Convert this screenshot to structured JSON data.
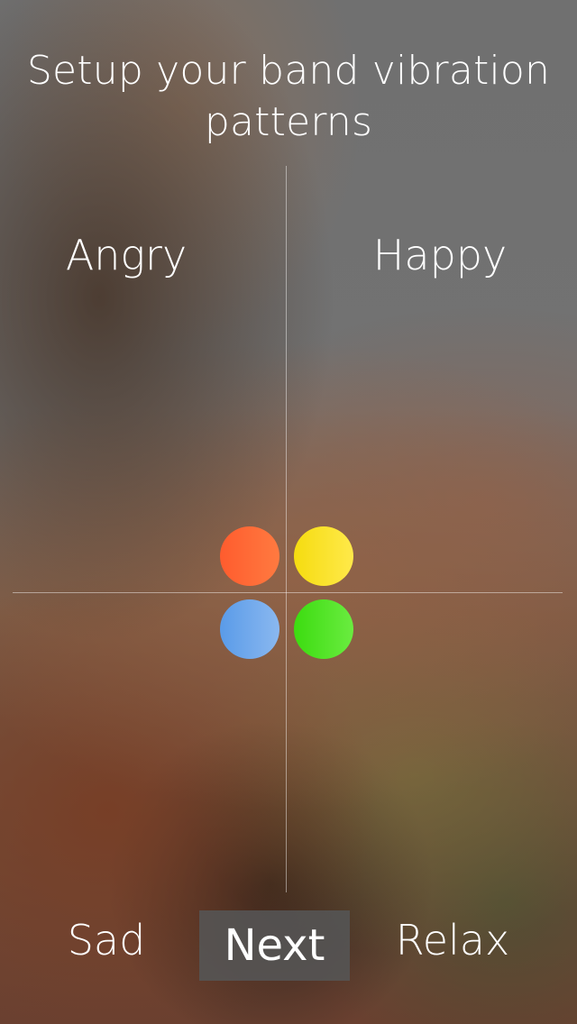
{
  "title": "Setup your band vibration patterns",
  "moods": {
    "top_left": {
      "label": "Angry",
      "color": "#FF5C2E",
      "color2": "#FF7A40"
    },
    "top_right": {
      "label": "Happy",
      "color": "#F5DC10",
      "color2": "#FFE94A"
    },
    "bottom_left": {
      "label": "Sad",
      "color": "#5A9BE8",
      "color2": "#8AB8F0"
    },
    "bottom_right": {
      "label": "Relax",
      "color": "#3CDC10",
      "color2": "#6AEC40"
    }
  },
  "next_button": {
    "label": "Next"
  }
}
